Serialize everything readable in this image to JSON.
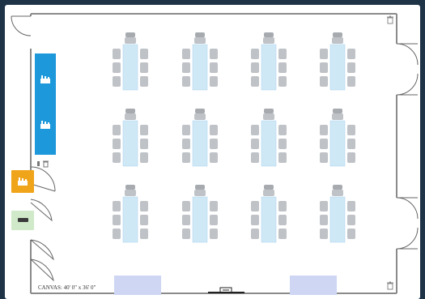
{
  "canvas": {
    "label": "CANVAS: 40' 0\" x 36' 0\""
  },
  "colors": {
    "background": "#1f3347",
    "wall": "#8a8a8a",
    "table": "#cfe8f6",
    "table_border": "#a9d2ec",
    "chair": "#bfc2c6",
    "chair_dark": "#a7abb0",
    "projection_screen": "#cfd6f4",
    "blue_panel": "#1c98db",
    "orange_panel": "#f0a419",
    "green_panel": "#cfe9c9"
  },
  "layout": {
    "rows": 3,
    "cols": 4,
    "table_count": 12,
    "chairs_per_side": 3,
    "head_chair": true
  },
  "icons": {
    "blue_panel": [
      "stage-icon",
      "stage-icon"
    ],
    "orange_panel": "podium-icon",
    "green_panel": "rectangle-table-icon",
    "trash": "trash-icon",
    "door": "door-icon",
    "bottom_center": "tv-icon"
  }
}
